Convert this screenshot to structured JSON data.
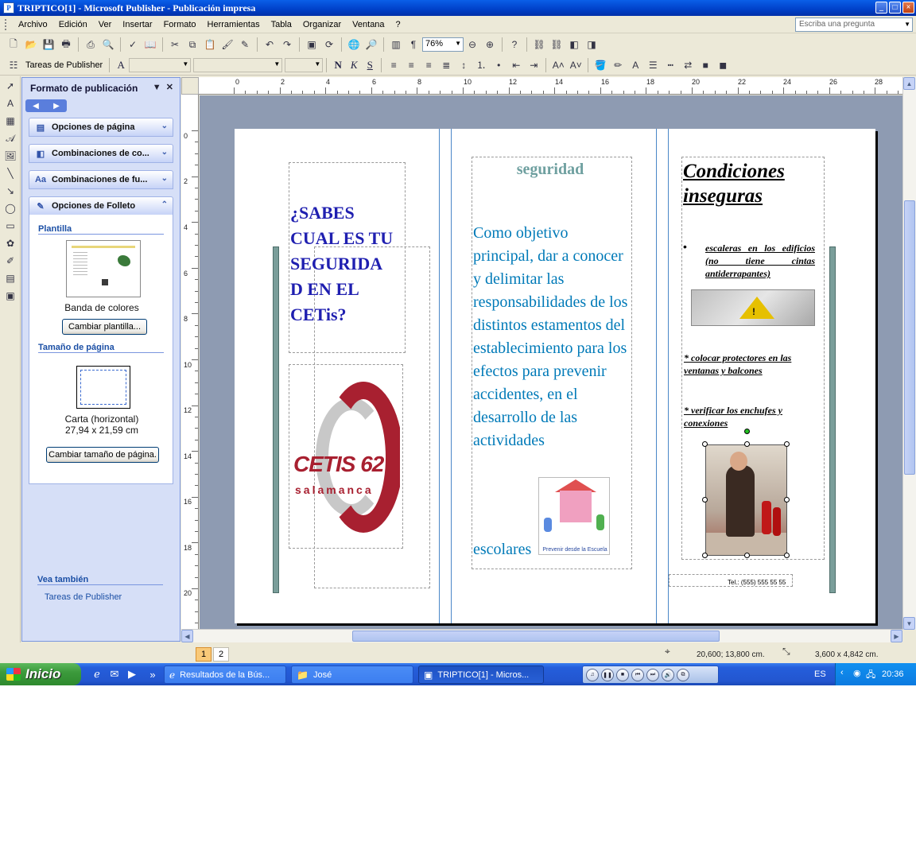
{
  "window": {
    "title": "TRIPTICO[1] - Microsoft Publisher - Publicación impresa",
    "buttons": {
      "minimize": "_",
      "maximize": "□",
      "close": "×"
    }
  },
  "menu": {
    "items": [
      "Archivo",
      "Edición",
      "Ver",
      "Insertar",
      "Formato",
      "Herramientas",
      "Tabla",
      "Organizar",
      "Ventana",
      "?"
    ],
    "ask_placeholder": "Escriba una pregunta"
  },
  "toolbar": {
    "zoom": "76%",
    "tasks_label": "Tareas de Publisher",
    "font_name": "",
    "font_size": "",
    "style": ""
  },
  "taskpane": {
    "title": "Formato de publicación",
    "sections": [
      {
        "label": "Opciones de página",
        "icon": "page-options-icon"
      },
      {
        "label": "Combinaciones de co...",
        "icon": "color-scheme-icon"
      },
      {
        "label": "Combinaciones de fu...",
        "icon": "font-scheme-icon"
      },
      {
        "label": "Opciones de Folleto",
        "icon": "brochure-options-icon"
      }
    ],
    "template_heading": "Plantilla",
    "template_name": "Banda de colores",
    "change_template": "Cambiar plantilla...",
    "page_size_heading": "Tamaño de página",
    "page_size_name": "Carta (horizontal)",
    "page_size_dims": "27,94 x 21,59 cm",
    "change_page_size": "Cambiar tamaño de página.",
    "see_also_heading": "Vea también",
    "see_also_link": "Tareas de Publisher"
  },
  "rulers": {
    "h_labels": [
      "0",
      "2",
      "4",
      "6",
      "8",
      "10",
      "12",
      "14",
      "16",
      "18",
      "20",
      "22",
      "24",
      "26",
      "28"
    ],
    "v_labels": [
      "0",
      "2",
      "4",
      "6",
      "8",
      "10",
      "12",
      "14",
      "16",
      "18",
      "20"
    ]
  },
  "document": {
    "question": "¿SABES CUAL ES TU SEGURIDA D EN EL CETis?",
    "logo_text": "CETIS 62",
    "logo_sub": "salamanca",
    "heading_security": "seguridad",
    "objective": "Como objetivo principal, dar a conocer y delimitar las responsabilidades de los distintos estamentos del establecimiento para los efectos para prevenir accidentes, en el desarrollo de las actividades",
    "objective_end": "escolares",
    "kids_caption": "Prevenir desde la Escuela",
    "unsafe_title": "Condiciones inseguras",
    "bullet1": "escaleras en los edificios (no tiene cintas antiderrapantes)",
    "point2": "* colocar protectores en las ventanas y balcones",
    "point3": "* verificar los enchufes y conexiones",
    "phone": "Tel.: (555) 555 55 55"
  },
  "status": {
    "pages": [
      "1",
      "2"
    ],
    "position": "20,600; 13,800 cm.",
    "size": "3,600 x 4,842 cm."
  },
  "taskbar": {
    "start": "Inicio",
    "items": [
      "Resultados de la Bús...",
      "José",
      "TRIPTICO[1] - Micros..."
    ],
    "lang": "ES",
    "clock": "20:36"
  },
  "colors": {
    "question_text": "#1F1FB0",
    "objective_text": "#007ab8",
    "security_heading": "#6FA0A0",
    "teal_bar": "#7A9E9A",
    "logo_red": "#a82030"
  }
}
